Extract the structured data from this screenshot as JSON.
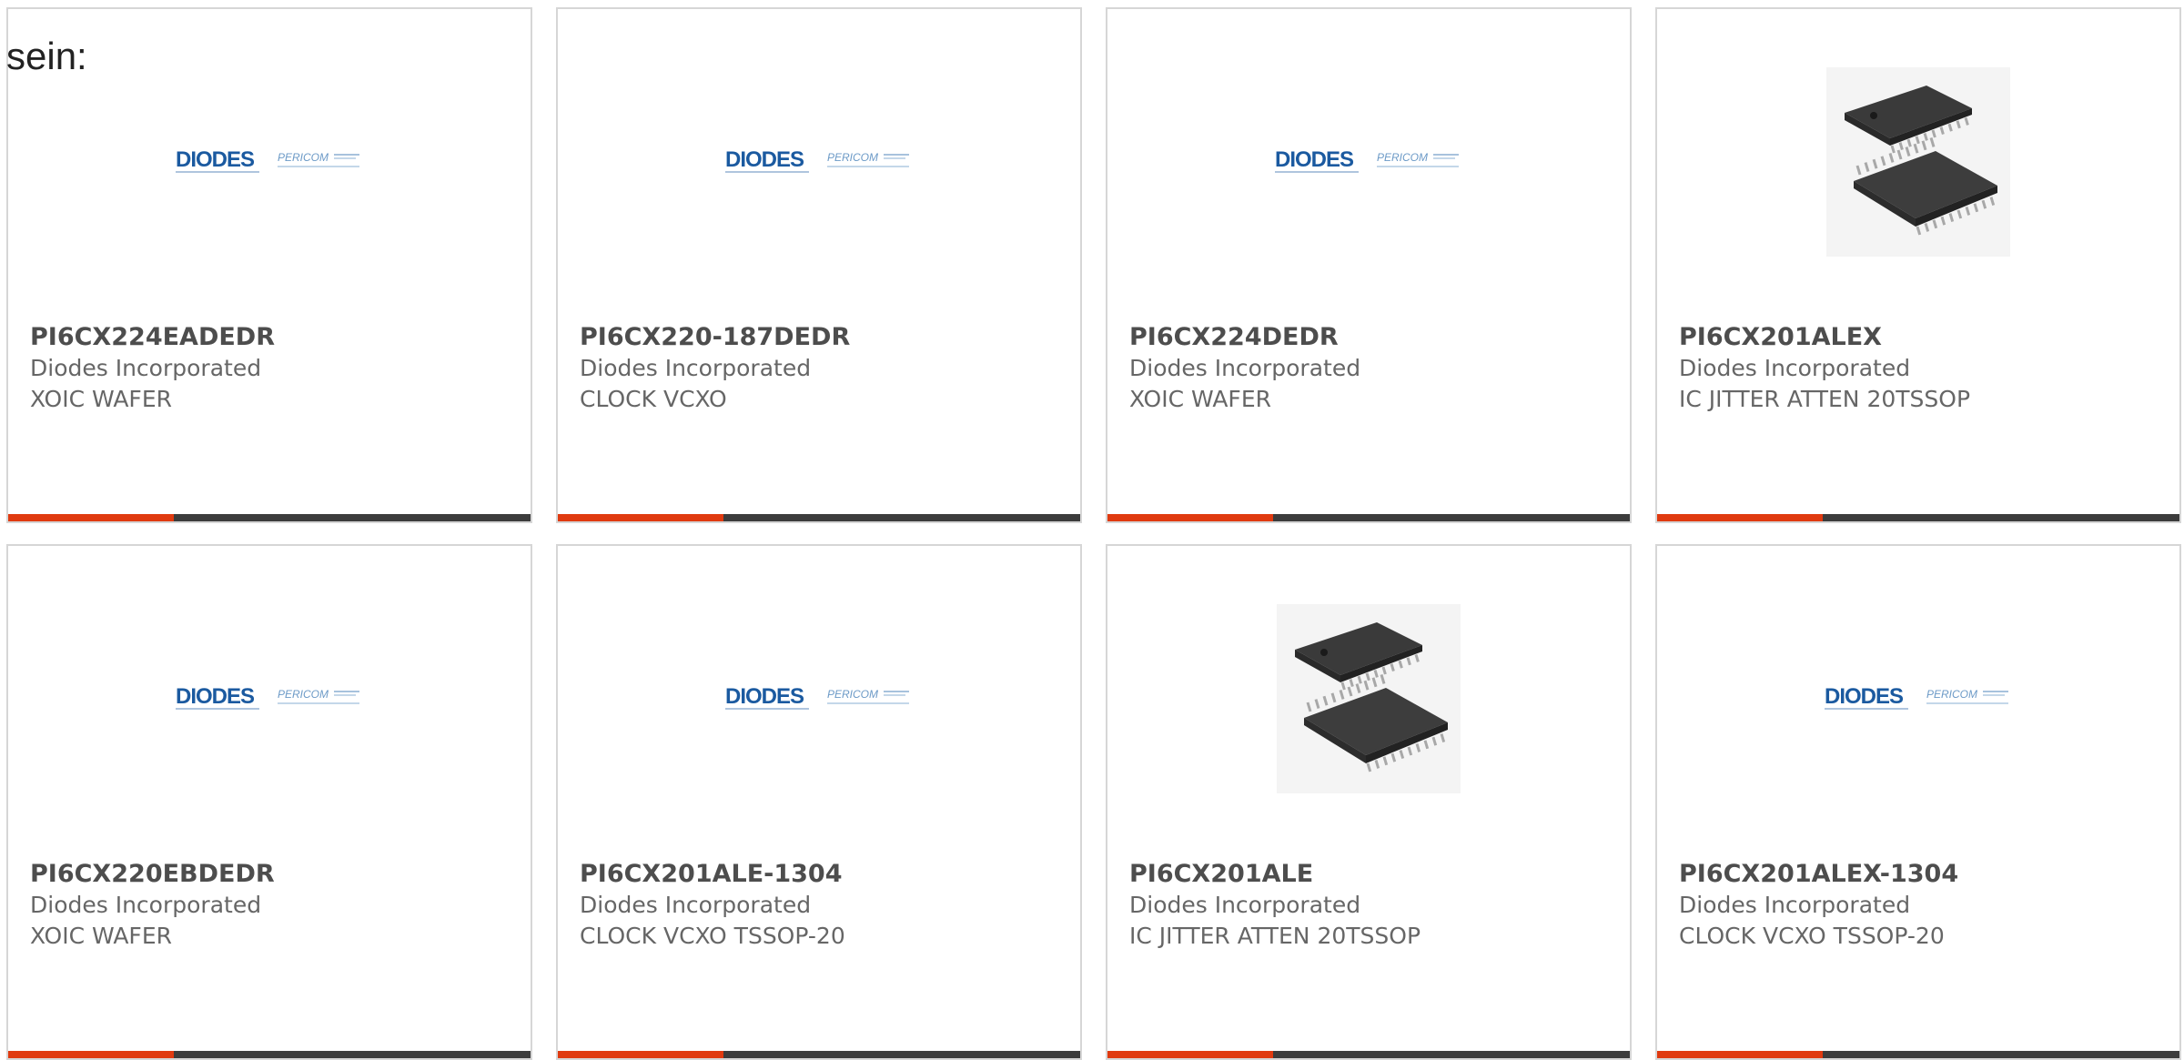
{
  "intro_text": "sein:",
  "colors": {
    "accent": "#e03a10",
    "bar": "#3c3c3c",
    "diodes_blue": "#1b5aa0",
    "pericom_blue": "#6c9ac7"
  },
  "logo": {
    "diodes": "DIODES",
    "pericom": "PERICOM"
  },
  "products": [
    {
      "part_number": "PI6CX224EADEDR",
      "manufacturer": "Diodes Incorporated",
      "description": "XOIC WAFER",
      "image": "diodes-pericom-logo"
    },
    {
      "part_number": "PI6CX220-187DEDR",
      "manufacturer": "Diodes Incorporated",
      "description": "CLOCK VCXO",
      "image": "diodes-pericom-logo"
    },
    {
      "part_number": "PI6CX224DEDR",
      "manufacturer": "Diodes Incorporated",
      "description": "XOIC WAFER",
      "image": "diodes-pericom-logo"
    },
    {
      "part_number": "PI6CX201ALEX",
      "manufacturer": "Diodes Incorporated",
      "description": "IC JITTER ATTEN 20TSSOP",
      "image": "tssop-chip-photo"
    },
    {
      "part_number": "PI6CX220EBDEDR",
      "manufacturer": "Diodes Incorporated",
      "description": "XOIC WAFER",
      "image": "diodes-pericom-logo"
    },
    {
      "part_number": "PI6CX201ALE-1304",
      "manufacturer": "Diodes Incorporated",
      "description": "CLOCK VCXO TSSOP-20",
      "image": "diodes-pericom-logo"
    },
    {
      "part_number": "PI6CX201ALE",
      "manufacturer": "Diodes Incorporated",
      "description": "IC JITTER ATTEN 20TSSOP",
      "image": "tssop-chip-photo"
    },
    {
      "part_number": "PI6CX201ALEX-1304",
      "manufacturer": "Diodes Incorporated",
      "description": "CLOCK VCXO TSSOP-20",
      "image": "diodes-pericom-logo"
    }
  ]
}
